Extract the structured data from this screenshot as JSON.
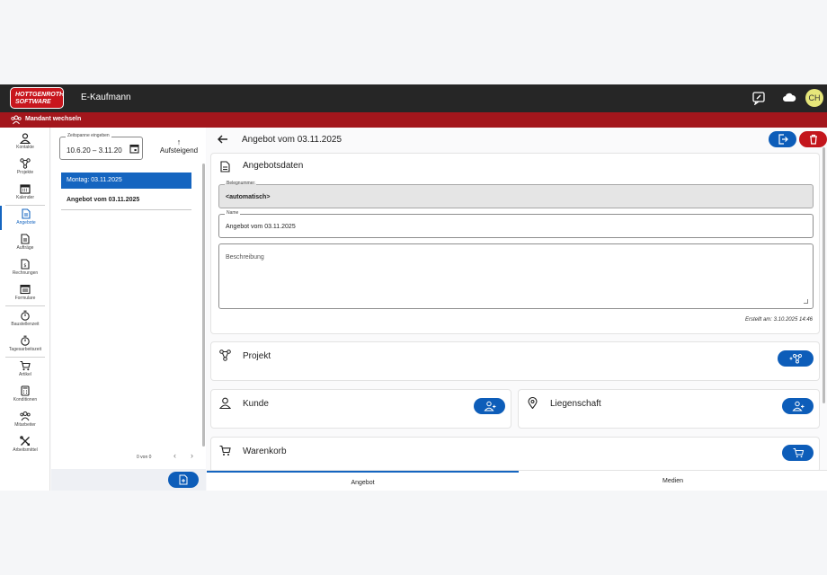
{
  "app": {
    "logo_line1": "HOTTGENROTH",
    "logo_line2": "SOFTWARE",
    "title": "E-Kaufmann",
    "user_initials": "CH"
  },
  "mandant_bar": {
    "label": "Mandant wechseln"
  },
  "nav": {
    "items": [
      {
        "label": "Kontakte",
        "icon": "person-icon"
      },
      {
        "label": "Projekte",
        "icon": "project-icon"
      },
      {
        "label": "Kalender",
        "icon": "calendar-icon"
      },
      {
        "label": "Angebote",
        "icon": "document-icon"
      },
      {
        "label": "Aufträge",
        "icon": "document-icon"
      },
      {
        "label": "Rechnungen",
        "icon": "invoice-icon"
      },
      {
        "label": "Formulare",
        "icon": "form-icon"
      },
      {
        "label": "Baustellenzeit",
        "icon": "stopwatch-icon"
      },
      {
        "label": "Tagesarbeitszeit",
        "icon": "stopwatch-icon"
      },
      {
        "label": "Artikel",
        "icon": "cart-icon"
      },
      {
        "label": "Konditionen",
        "icon": "calculator-icon"
      },
      {
        "label": "Mitarbeiter",
        "icon": "group-icon"
      },
      {
        "label": "Arbeitsmittel",
        "icon": "tools-icon"
      }
    ],
    "active": "Angebote"
  },
  "list": {
    "zeitspanne_label": "Zeitspanne eingeben",
    "zeitspanne_value": "10.6.20 – 3.11.20",
    "sort_label": "Aufsteigend",
    "group_header": "Montag: 03.11.2025",
    "rows": [
      "Angebot vom 03.11.2025"
    ],
    "pager_text": "0 von 0"
  },
  "main": {
    "title": "Angebot vom 03.11.2025",
    "angebotsdaten": {
      "title": "Angebotsdaten",
      "belegnummer_label": "Belegnummer",
      "belegnummer_value": "<automatisch>",
      "name_label": "Name",
      "name_value": "Angebot vom 03.11.2025",
      "beschreibung_placeholder": "Beschreibung",
      "created": "Erstellt am: 3.10.2025 14:46"
    },
    "projekt_title": "Projekt",
    "kunde_title": "Kunde",
    "liegenschaft_title": "Liegenschaft",
    "warenkorb_title": "Warenkorb",
    "tabs": [
      "Angebot",
      "Medien"
    ],
    "active_tab": "Angebot"
  },
  "colors": {
    "accent": "#1565c0",
    "brand_red": "#a3161c",
    "topbar": "#262626"
  }
}
